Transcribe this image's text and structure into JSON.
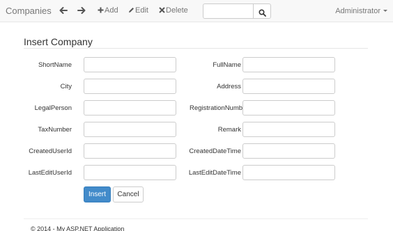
{
  "navbar": {
    "brand": "Companies",
    "back_icon": "arrow-left-icon",
    "forward_icon": "arrow-right-icon",
    "add_label": "Add",
    "add_icon": "plus-icon",
    "edit_label": "Edit",
    "edit_icon": "pencil-icon",
    "delete_label": "Delete",
    "delete_icon": "x-icon",
    "search": {
      "value": "",
      "placeholder": "",
      "icon": "search-icon"
    },
    "user_label": "Administrator",
    "user_icon": "caret-down-icon"
  },
  "form": {
    "title": "Insert Company",
    "fields": {
      "short_name": {
        "label": "ShortName",
        "value": ""
      },
      "full_name": {
        "label": "FullName",
        "value": ""
      },
      "city": {
        "label": "City",
        "value": ""
      },
      "address": {
        "label": "Address",
        "value": ""
      },
      "legal_person": {
        "label": "LegalPerson",
        "value": ""
      },
      "registration_number": {
        "label": "RegistrationNumber",
        "value": ""
      },
      "tax_number": {
        "label": "TaxNumber",
        "value": ""
      },
      "remark": {
        "label": "Remark",
        "value": ""
      },
      "created_user_id": {
        "label": "CreatedUserId",
        "value": ""
      },
      "created_date_time": {
        "label": "CreatedDateTime",
        "value": ""
      },
      "last_edit_user_id": {
        "label": "LastEditUserId",
        "value": ""
      },
      "last_edit_date_time": {
        "label": "LastEditDateTime",
        "value": ""
      }
    },
    "insert_label": "Insert",
    "cancel_label": "Cancel"
  },
  "footer": {
    "text": "© 2014 - My ASP.NET Application"
  },
  "colors": {
    "primary": "#428bca",
    "navbar_bg": "#f8f8f8",
    "navbar_text": "#777777"
  }
}
